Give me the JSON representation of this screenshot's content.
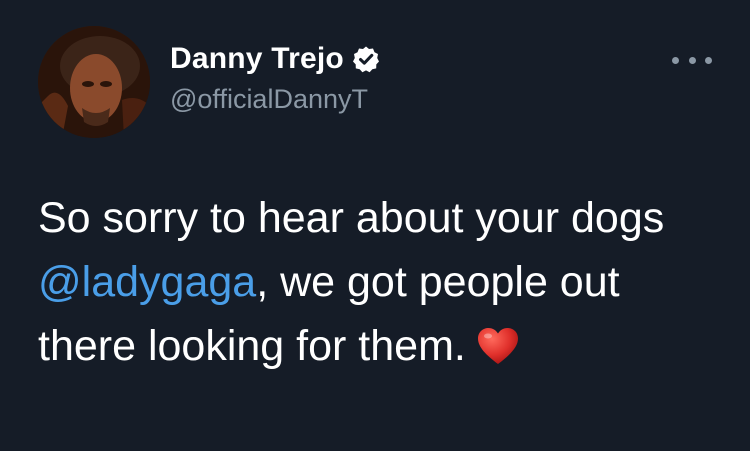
{
  "author": {
    "display_name": "Danny Trejo",
    "handle": "@officialDannyT",
    "verified": true,
    "avatar_icon": "profile-photo"
  },
  "tweet": {
    "text_part1": "So sorry to hear about your dogs ",
    "mention": "@ladygaga",
    "text_part2": ", we got people out there looking for them.",
    "emoji": "❤️",
    "emoji_icon": "red-heart-icon"
  },
  "colors": {
    "background": "#151c27",
    "link": "#4a9ee8",
    "secondary_text": "#8b98a5",
    "heart": "#e0302b"
  }
}
